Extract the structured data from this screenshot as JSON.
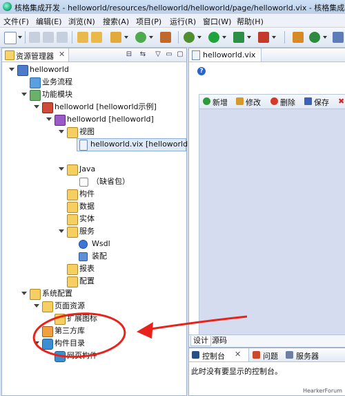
{
  "window": {
    "title": "核格集成开发 - helloworld/resources/helloworld/helloworld/page/helloworld.vix - 核格集成开"
  },
  "menu": [
    "文件(F)",
    "编辑(E)",
    "浏览(N)",
    "搜索(A)",
    "项目(P)",
    "运行(R)",
    "窗口(W)",
    "帮助(H)"
  ],
  "explorer": {
    "tab_label": "资源管理器",
    "tree": {
      "project": "helloworld",
      "business_flow": "业务流程",
      "func_module": "功能模块",
      "example": "helloworld [helloworld示例]",
      "module": "helloworld [helloworld]",
      "view": "视图",
      "vix_file": "helloworld.vix [helloworld]",
      "java": "Java",
      "default_pkg": "（缺省包）",
      "component": "构件",
      "data": "数据",
      "entity": "实体",
      "service": "服务",
      "wsdl": "Wsdl",
      "assembly": "装配",
      "report": "报表",
      "config": "配置",
      "sys_config": "系统配置",
      "page_resource": "页面资源",
      "ext_icon": "扩展图标",
      "third_party": "第三方库",
      "component_dir": "构件目录",
      "web_component": "网页构件"
    }
  },
  "editor": {
    "tab_label": "helloworld.vix",
    "toolbar": {
      "new": "新增",
      "modify": "修改",
      "delete": "删除",
      "save": "保存"
    },
    "bottom_tabs": [
      "设计",
      "源码"
    ]
  },
  "console": {
    "tabs": [
      "控制台",
      "问题",
      "服务器"
    ],
    "message": "此时没有要显示的控制台。"
  },
  "watermark": "HearkerForum",
  "colors": {
    "annotation": "#e8231b",
    "canvas": "#d6dcf0"
  }
}
